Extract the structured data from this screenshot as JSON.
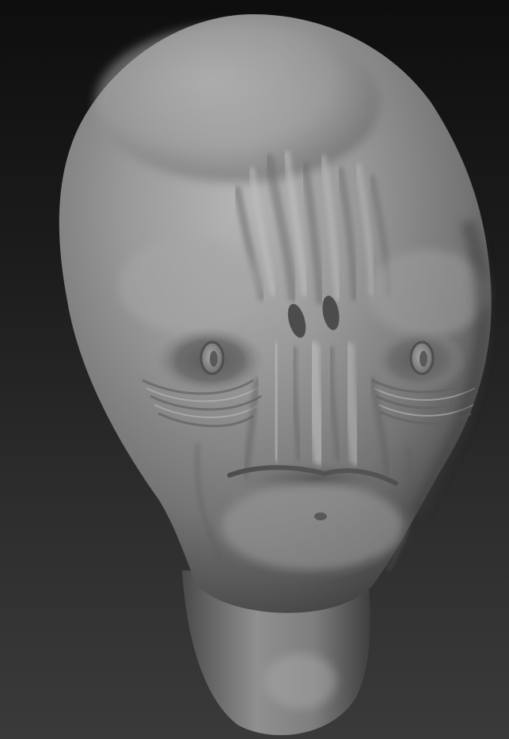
{
  "scene": {
    "background_top": "#0e0e0e",
    "background_bottom": "#3a3a3a",
    "material_color": "#8a8a8a",
    "subject": "sculpted-alien-head"
  }
}
